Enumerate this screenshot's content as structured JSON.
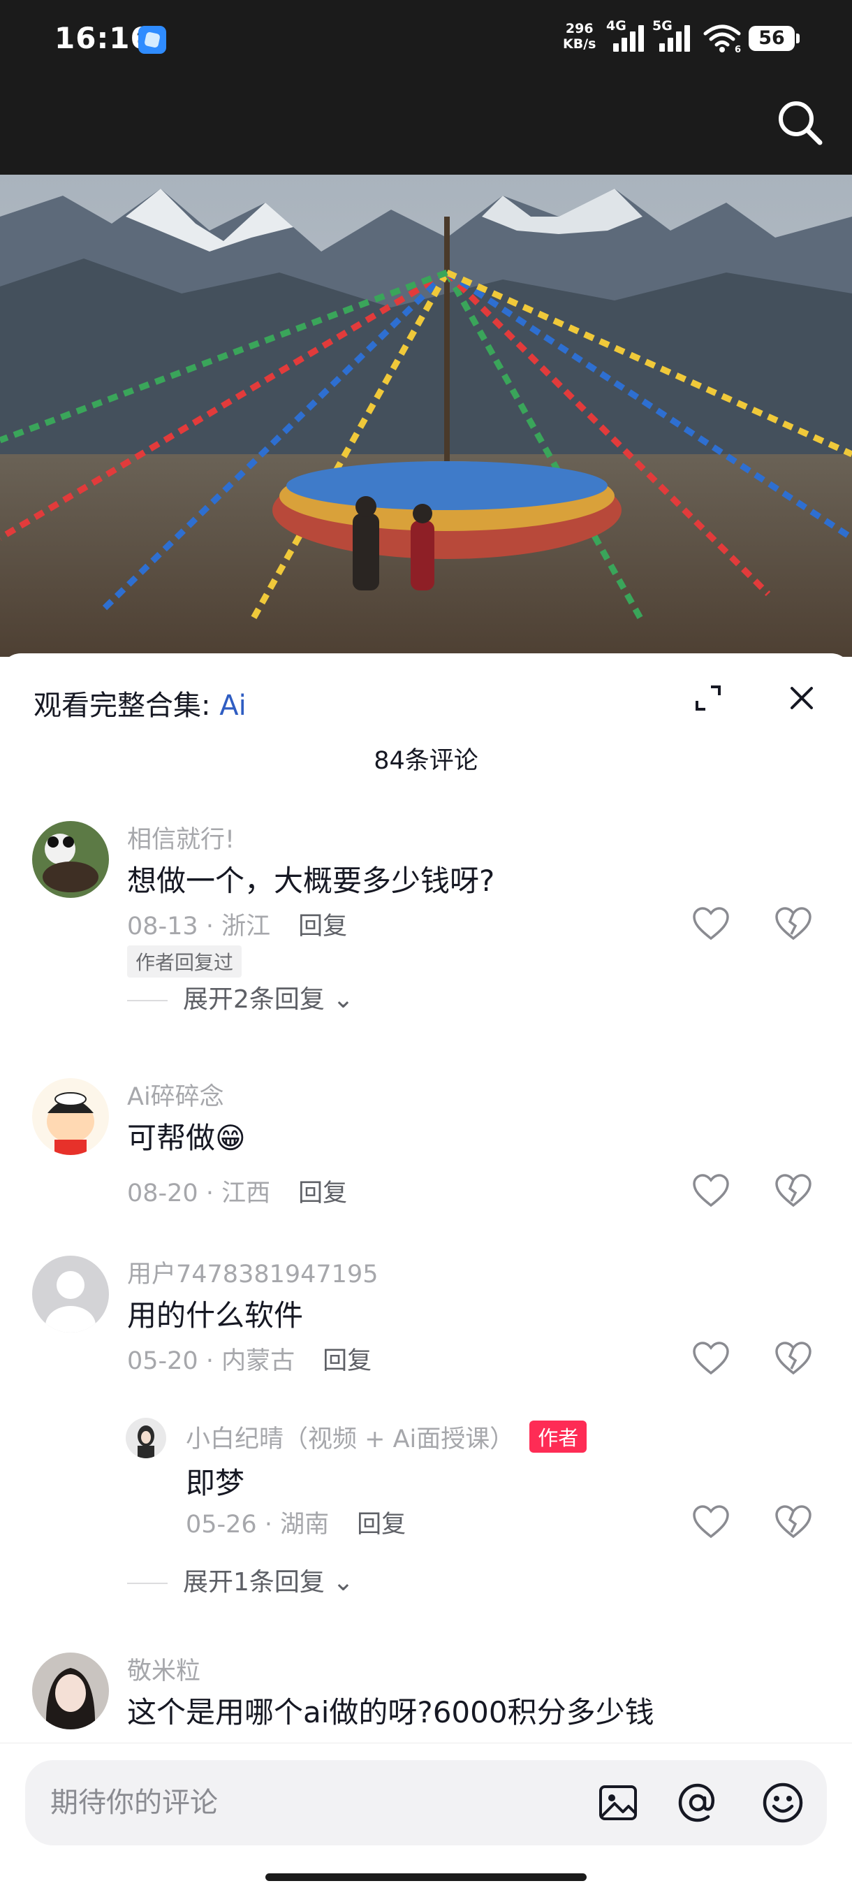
{
  "status_bar": {
    "time": "16:16",
    "speed_value": "296",
    "speed_unit": "KB/s",
    "net1": "4G",
    "net2": "5G",
    "wifi_sub": "6",
    "battery": "56"
  },
  "comments_panel": {
    "collection_prefix": "观看完整合集: ",
    "collection_link": "Ai",
    "count": "84条评论",
    "comments": [
      {
        "user": "相信就行!",
        "text": "想做一个，大概要多少钱呀?",
        "date": "08-13",
        "location": "浙江",
        "reply_label": "回复",
        "tag": "作者回复过",
        "expand_label": "展开2条回复"
      },
      {
        "user": "Ai碎碎念",
        "text": "可帮做😁",
        "date": "08-20",
        "location": "江西",
        "reply_label": "回复"
      },
      {
        "user": "用户7478381947195",
        "text": "用的什么软件",
        "date": "05-20",
        "location": "内蒙古",
        "reply_label": "回复",
        "reply": {
          "user": "小白纪晴（视频 + Ai面授课）",
          "badge": "作者",
          "text": "即梦",
          "date": "05-26",
          "location": "湖南",
          "reply_label": "回复"
        },
        "expand_label": "展开1条回复"
      },
      {
        "user": "敬米粒",
        "text": "这个是用哪个ai做的呀?6000积分多少钱"
      }
    ]
  },
  "comment_input": {
    "placeholder": "期待你的评论"
  },
  "icons": {
    "search": "search-icon",
    "expand": "expand-icon",
    "close": "close-icon",
    "like": "heart-icon",
    "dislike": "broken-heart-icon",
    "image": "image-icon",
    "mention": "at-icon",
    "emoji": "emoji-icon"
  },
  "colors": {
    "accent_link": "#2f5dc2",
    "author_badge": "#fe2c55",
    "meta_text": "#a6a7ab"
  }
}
